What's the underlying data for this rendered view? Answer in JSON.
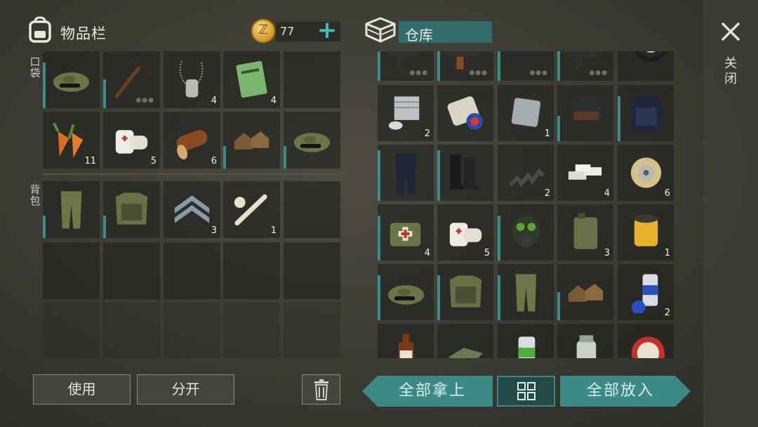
{
  "inventory": {
    "title": "物品栏",
    "gold_amount": "77",
    "add_gold_label": "+",
    "pocket_label": "口袋",
    "backpack_label": "背包",
    "pocket_slots": [
      {
        "item": "camo-cap-icon",
        "count": "",
        "bar": 0.8,
        "dots": false
      },
      {
        "item": "pickaxe-icon",
        "count": "",
        "bar": 0.5,
        "dots": true
      },
      {
        "item": "dog-tags-icon",
        "count": "4",
        "bar": 0,
        "dots": false
      },
      {
        "item": "notebook-icon",
        "count": "4",
        "bar": 0,
        "dots": false
      },
      {
        "item": "",
        "count": "",
        "bar": 0,
        "dots": false
      },
      {
        "item": "carrots-icon",
        "count": "11",
        "bar": 0,
        "dots": false
      },
      {
        "item": "bandage-icon",
        "count": "5",
        "bar": 0,
        "dots": false
      },
      {
        "item": "log-icon",
        "count": "6",
        "bar": 0,
        "dots": false
      },
      {
        "item": "boots-icon",
        "count": "",
        "bar": 0.4,
        "dots": false
      },
      {
        "item": "camo-cap-icon",
        "count": "",
        "bar": 0.4,
        "dots": false
      }
    ],
    "backpack_slots": [
      {
        "item": "camo-pants-icon",
        "count": "",
        "bar": 0.4,
        "dots": false
      },
      {
        "item": "camo-vest-icon",
        "count": "",
        "bar": 0.4,
        "dots": false
      },
      {
        "item": "sergeant-badge-icon",
        "count": "3",
        "bar": 0,
        "dots": false
      },
      {
        "item": "bones-icon",
        "count": "1",
        "bar": 0,
        "dots": false
      },
      {
        "item": "",
        "count": "",
        "bar": 0,
        "dots": false
      }
    ]
  },
  "buttons": {
    "use": "使用",
    "split": "分开",
    "take_all": "全部拿上",
    "put_all": "全部放入"
  },
  "storage": {
    "title": "仓库",
    "slots": [
      {
        "item": "assault-rifle-icon",
        "count": "",
        "bar": 0.6,
        "dots": true
      },
      {
        "item": "ak-rifle-icon",
        "count": "",
        "bar": 0.6,
        "dots": true
      },
      {
        "item": "smg-icon",
        "count": "",
        "bar": 0.6,
        "dots": true
      },
      {
        "item": "assault-rifle-icon",
        "count": "",
        "bar": 0.6,
        "dots": true
      },
      {
        "item": "tire-icon",
        "count": "",
        "bar": 0,
        "dots": false
      },
      {
        "item": "engine-cylinder-icon",
        "count": "2",
        "bar": 0,
        "dots": false
      },
      {
        "item": "flag-roll-icon",
        "count": "",
        "bar": 0,
        "dots": false
      },
      {
        "item": "metal-plate-icon",
        "count": "1",
        "bar": 0,
        "dots": false
      },
      {
        "item": "helmet-icon",
        "count": "",
        "bar": 0.45,
        "dots": false
      },
      {
        "item": "tactical-vest-icon",
        "count": "",
        "bar": 0.8,
        "dots": false
      },
      {
        "item": "tactical-pants-icon",
        "count": "",
        "bar": 0.9,
        "dots": false
      },
      {
        "item": "combat-boots-icon",
        "count": "",
        "bar": 0.9,
        "dots": false
      },
      {
        "item": "spring-icon",
        "count": "2",
        "bar": 0,
        "dots": false
      },
      {
        "item": "silver-bars-icon",
        "count": "4",
        "bar": 0,
        "dots": false
      },
      {
        "item": "wire-spool-icon",
        "count": "6",
        "bar": 0,
        "dots": false
      },
      {
        "item": "medkit-bag-icon",
        "count": "4",
        "bar": 0.8,
        "dots": false
      },
      {
        "item": "bandage-icon",
        "count": "5",
        "bar": 0,
        "dots": false
      },
      {
        "item": "gas-mask-icon",
        "count": "",
        "bar": 0.8,
        "dots": false
      },
      {
        "item": "jerrycan-icon",
        "count": "3",
        "bar": 0,
        "dots": false
      },
      {
        "item": "oil-filter-icon",
        "count": "1",
        "bar": 0,
        "dots": false
      },
      {
        "item": "camo-cap-icon",
        "count": "",
        "bar": 0.8,
        "dots": false
      },
      {
        "item": "camo-vest-icon",
        "count": "",
        "bar": 0.8,
        "dots": false
      },
      {
        "item": "camo-pants-icon",
        "count": "",
        "bar": 0.8,
        "dots": false
      },
      {
        "item": "boots-icon",
        "count": "",
        "bar": 0.5,
        "dots": false
      },
      {
        "item": "spray-paint-icon",
        "count": "2",
        "bar": 0,
        "dots": false
      },
      {
        "item": "bottle-icon",
        "count": "",
        "bar": 0,
        "dots": false
      },
      {
        "item": "cloth-icon",
        "count": "",
        "bar": 0,
        "dots": false
      },
      {
        "item": "spray-can-green-icon",
        "count": "",
        "bar": 0,
        "dots": false
      },
      {
        "item": "glass-jar-icon",
        "count": "",
        "bar": 0,
        "dots": false
      },
      {
        "item": "bottle-cap-icon",
        "count": "",
        "bar": 0,
        "dots": false
      }
    ]
  },
  "close_label": "关闭",
  "colors": {
    "accent": "#3c8a85",
    "durability": "#3a8c88",
    "gold": "#d8a53a"
  }
}
